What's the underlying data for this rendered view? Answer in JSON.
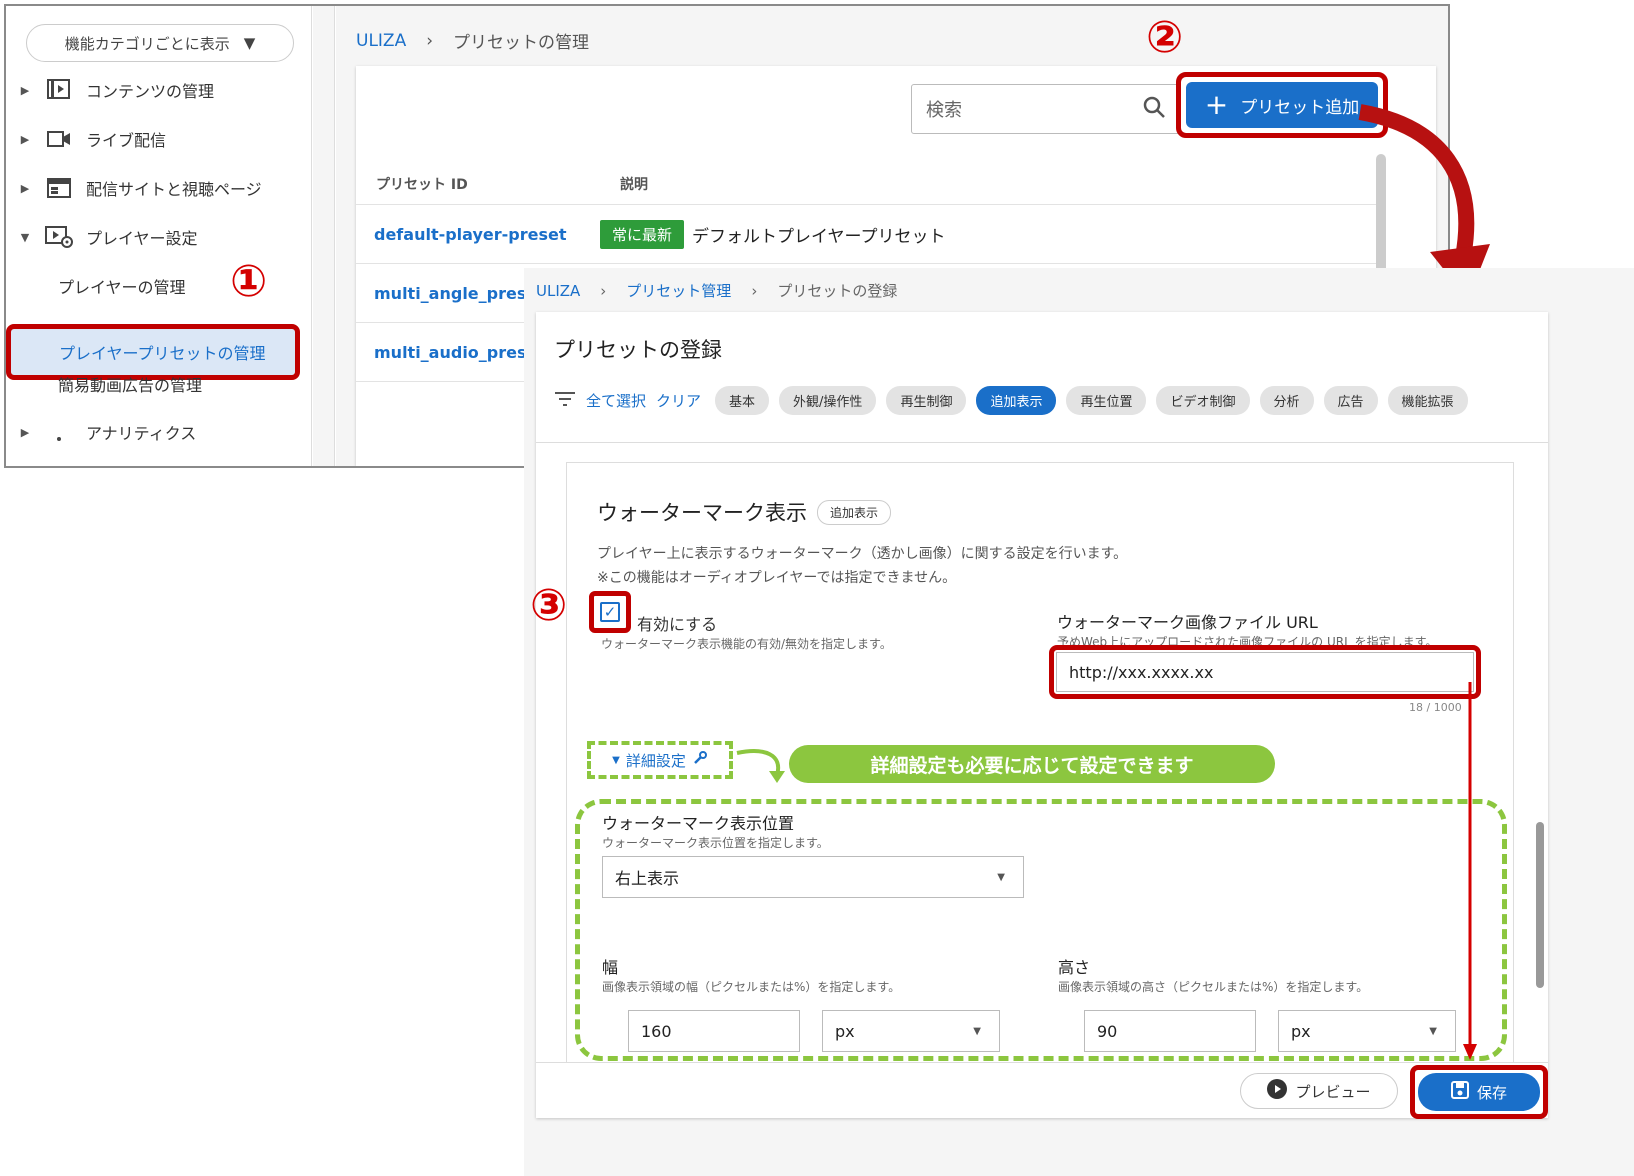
{
  "screen1": {
    "sidebar": {
      "category_select": "機能カテゴリごとに表示",
      "items": [
        {
          "label": "コンテンツの管理",
          "icon": "play-list-icon"
        },
        {
          "label": "ライブ配信",
          "icon": "video-camera-icon"
        },
        {
          "label": "配信サイトと視聴ページ",
          "icon": "web-layout-icon"
        },
        {
          "label": "プレイヤー設定",
          "icon": "player-settings-icon"
        }
      ],
      "sub_items": [
        "プレイヤーの管理",
        "プレイヤープリセットの管理",
        "簡易動画広告の管理"
      ],
      "last_item": "アナリティクス"
    },
    "breadcrumb": {
      "root": "ULIZA",
      "current": "プリセットの管理"
    },
    "search_placeholder": "検索",
    "add_button": "プリセット追加",
    "table": {
      "headers": [
        "プリセット ID",
        "説明"
      ],
      "rows": [
        {
          "id": "default-player-preset",
          "badge": "常に最新",
          "description": "デフォルトプレイヤープリセット"
        },
        {
          "id": "multi_angle_preset",
          "badge": "",
          "description": ""
        },
        {
          "id": "multi_audio_preset",
          "badge": "",
          "description": ""
        }
      ]
    }
  },
  "screen2": {
    "breadcrumb": {
      "root": "ULIZA",
      "parent": "プリセット管理",
      "current": "プリセットの登録"
    },
    "title": "プリセットの登録",
    "filter": {
      "select_all": "全て選択",
      "clear": "クリア",
      "chips": [
        "基本",
        "外観/操作性",
        "再生制御",
        "追加表示",
        "再生位置",
        "ビデオ制御",
        "分析",
        "広告",
        "機能拡張"
      ],
      "active_chip": "追加表示"
    },
    "watermark": {
      "title": "ウォーターマーク表示",
      "tag": "追加表示",
      "desc1": "プレイヤー上に表示するウォーターマーク（透かし画像）に関する設定を行います。",
      "desc2": "※この機能はオーディオプレイヤーでは指定できません。",
      "enable_label": "有効にする",
      "enable_hint": "ウォーターマーク表示機能の有効/無効を指定します。",
      "url_label": "ウォーターマーク画像ファイル URL",
      "url_hint": "予めWeb上にアップロードされた画像ファイルの URL を指定します。",
      "url_value": "http://xxx.xxxx.xx",
      "url_counter": "18 / 1000",
      "detail_toggle": "詳細設定",
      "position_label": "ウォーターマーク表示位置",
      "position_hint": "ウォーターマーク表示位置を指定します。",
      "position_value": "右上表示",
      "width_label": "幅",
      "width_hint": "画像表示領域の幅（ピクセルまたは%）を指定します。",
      "width_value": "160",
      "width_unit": "px",
      "height_label": "高さ",
      "height_hint": "画像表示領域の高さ（ピクセルまたは%）を指定します。",
      "height_value": "90",
      "height_unit": "px"
    },
    "footer": {
      "preview": "プレビュー",
      "save": "保存"
    }
  },
  "annotations": {
    "step1": "①",
    "step2": "②",
    "step3": "③",
    "banner": "詳細設定も必要に応じて設定できます"
  },
  "colors": {
    "accent": "#1a6fc9",
    "highlight_red": "#c00000",
    "green": "#8cc63f",
    "badge_green": "#2e9c3a"
  }
}
